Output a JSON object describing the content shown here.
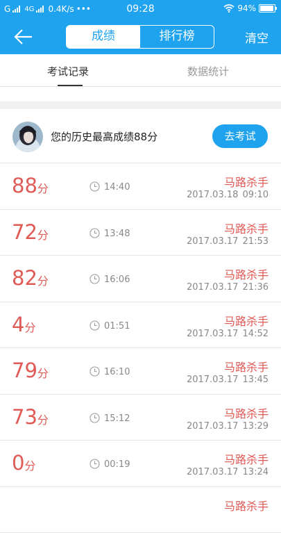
{
  "status_bar": {
    "carrier_left": "G",
    "network": "4G",
    "speed": "0.4K/s",
    "dots": "•••",
    "time": "09:28",
    "battery_percent": "94%",
    "battery_level": 0.94
  },
  "nav": {
    "segments": [
      {
        "label": "成绩",
        "active": true
      },
      {
        "label": "排行榜",
        "active": false
      }
    ],
    "clear_label": "清空"
  },
  "tabs": [
    {
      "label": "考试记录",
      "active": true
    },
    {
      "label": "数据统计",
      "active": false
    }
  ],
  "best": {
    "text": "您的历史最高成绩88分",
    "button_label": "去考试"
  },
  "records": [
    {
      "score": "88",
      "unit": "分",
      "duration": "14:40",
      "name": "马路杀手",
      "date": "2017.03.18  09:10"
    },
    {
      "score": "72",
      "unit": "分",
      "duration": "13:48",
      "name": "马路杀手",
      "date": "2017.03.17  21:53"
    },
    {
      "score": "82",
      "unit": "分",
      "duration": "16:06",
      "name": "马路杀手",
      "date": "2017.03.17  21:36"
    },
    {
      "score": "4",
      "unit": "分",
      "duration": "01:51",
      "name": "马路杀手",
      "date": "2017.03.17  14:52"
    },
    {
      "score": "79",
      "unit": "分",
      "duration": "16:10",
      "name": "马路杀手",
      "date": "2017.03.17  13:45"
    },
    {
      "score": "73",
      "unit": "分",
      "duration": "15:12",
      "name": "马路杀手",
      "date": "2017.03.17  13:29"
    },
    {
      "score": "0",
      "unit": "分",
      "duration": "00:19",
      "name": "马路杀手",
      "date": "2017.03.17  13:24"
    },
    {
      "score": "",
      "unit": "",
      "duration": "",
      "name": "马路杀手",
      "date": ""
    }
  ],
  "colors": {
    "brand": "#1fa3ee",
    "score": "#e05a56",
    "muted": "#888888"
  }
}
